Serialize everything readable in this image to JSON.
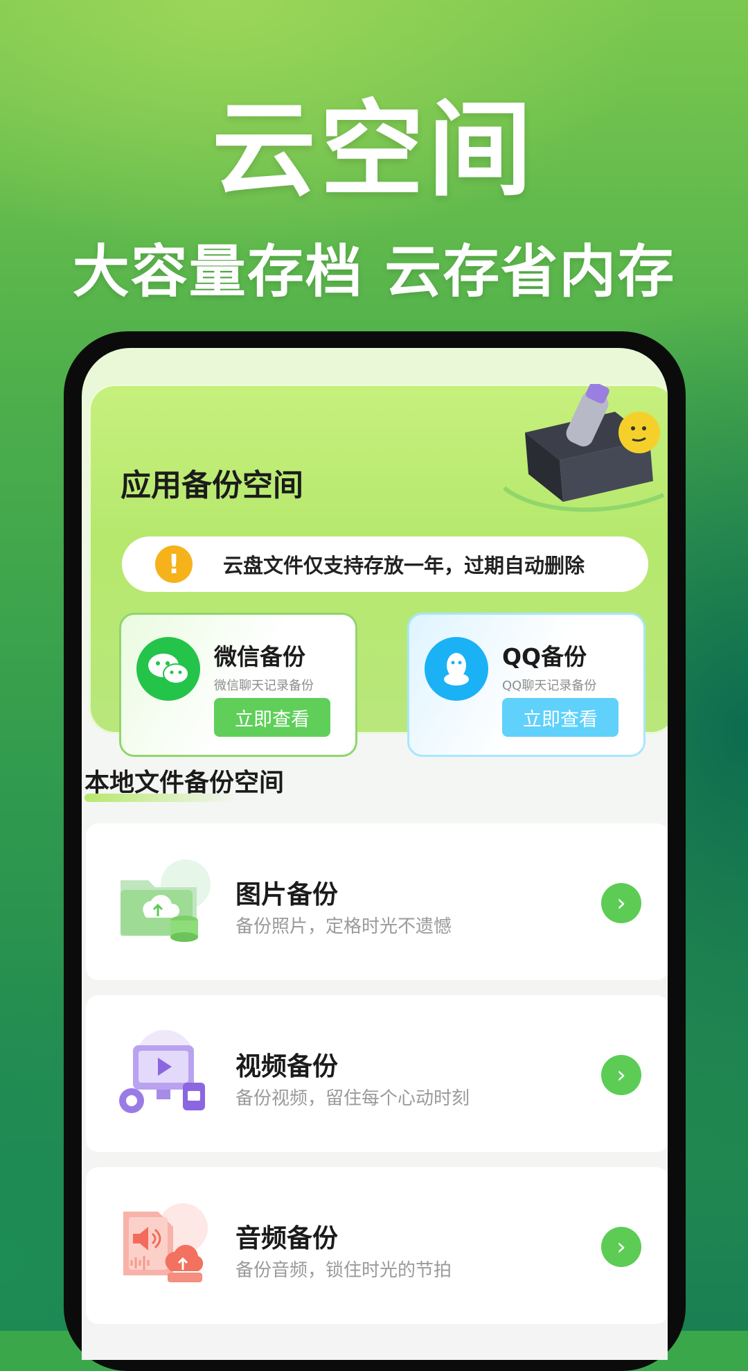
{
  "hero": {
    "title": "云空间",
    "subtitle": "大容量存档 云存省内存"
  },
  "app_backup": {
    "title": "应用备份空间",
    "notice": "云盘文件仅支持存放一年，过期自动删除",
    "notice_icon": "warning-icon",
    "cards": [
      {
        "title": "微信备份",
        "desc": "微信聊天记录备份",
        "button": "立即查看",
        "icon": "wechat-icon",
        "color": "#24c34a"
      },
      {
        "title": "QQ备份",
        "desc": "QQ聊天记录备份",
        "button": "立即查看",
        "icon": "qq-icon",
        "color": "#1ab2f5"
      }
    ]
  },
  "local_backup": {
    "title": "本地文件备份空间",
    "items": [
      {
        "title": "图片备份",
        "desc": "备份照片，定格时光不遗憾",
        "icon": "photo-folder-icon"
      },
      {
        "title": "视频备份",
        "desc": "备份视频，留住每个心动时刻",
        "icon": "video-monitor-icon"
      },
      {
        "title": "音频备份",
        "desc": "备份音频，锁住时光的节拍",
        "icon": "audio-file-icon"
      }
    ],
    "arrow_icon": "chevron-right-icon"
  },
  "colors": {
    "accent_green": "#5ccc55",
    "wechat_green": "#24c34a",
    "qq_blue": "#1ab2f5",
    "warning_yellow": "#f5b21b"
  }
}
